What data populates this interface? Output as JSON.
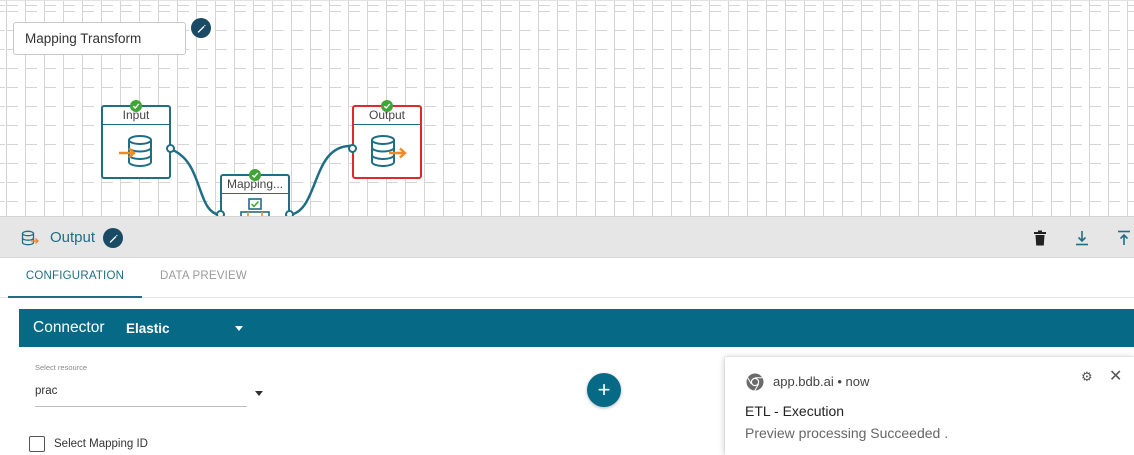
{
  "canvas": {
    "pipeline_name": "Mapping Transform",
    "nodes": [
      {
        "label": "Input",
        "status": "success",
        "selected": false
      },
      {
        "label": "Mapping...",
        "status": "success",
        "selected": false
      },
      {
        "label": "Output",
        "status": "success",
        "selected": true
      }
    ]
  },
  "panel": {
    "title": "Output",
    "tools": [
      "trash-icon",
      "download-icon",
      "upload-icon"
    ]
  },
  "tabs": [
    {
      "label": "CONFIGURATION",
      "active": true
    },
    {
      "label": "DATA PREVIEW",
      "active": false
    }
  ],
  "connector": {
    "label": "Connector",
    "value": "Elastic"
  },
  "form": {
    "resource_label": "Select resource",
    "resource_value": "prac",
    "mapping_checkbox_label": "Select Mapping ID",
    "mapping_checked": false,
    "add_symbol": "+"
  },
  "notification": {
    "source": "app.bdb.ai",
    "separator": "•",
    "time": "now",
    "title": "ETL - Execution",
    "body": "Preview processing Succeeded ."
  },
  "colors": {
    "accent": "#066a86",
    "node_border": "#1f6e86",
    "selected_border": "#e02a2a",
    "success": "#3fa535",
    "flow_arrow": "#f08a24"
  }
}
